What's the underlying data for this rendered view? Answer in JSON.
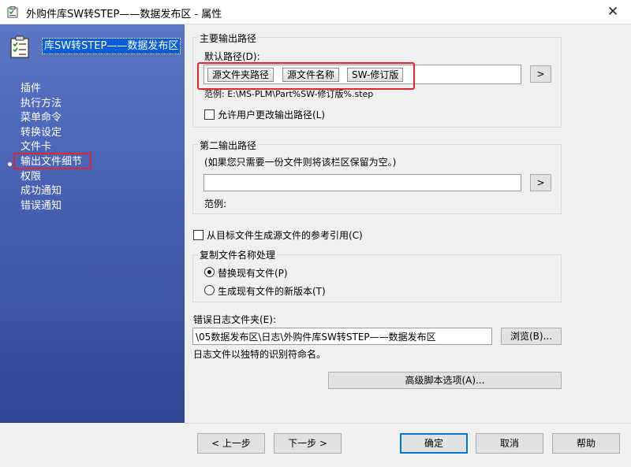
{
  "window": {
    "title": "外购件库SW转STEP——数据发布区 - 属性",
    "close_glyph": "✕"
  },
  "sidebar": {
    "item_name": "库SW转STEP——数据发布区",
    "items": [
      "插件",
      "执行方法",
      "菜单命令",
      "转换设定",
      "文件卡",
      "输出文件细节",
      "权限",
      "成功通知",
      "错误通知"
    ],
    "selected_index": 5
  },
  "primary_output": {
    "group_label": "主要输出路径",
    "default_path_label": "默认路径(D):",
    "tokens": [
      "源文件夹路径",
      "源文件名称",
      "SW-修订版"
    ],
    "browse_label": ">",
    "example": "范例: E:\\MS-PLM\\Part%SW-修订版%.step",
    "allow_change_label": "允许用户更改输出路径(L)",
    "allow_change_checked": false
  },
  "secondary_output": {
    "group_label": "第二输出路径",
    "hint": "(如果您只需要一份文件则将该栏区保留为空。)",
    "value": "",
    "browse_label": ">",
    "example": "范例:"
  },
  "reference": {
    "label": "从目标文件生成源文件的参考引用(C)",
    "checked": false
  },
  "copy_handling": {
    "group_label": "复制文件名称处理",
    "options": [
      {
        "label": "替换现有文件(P)",
        "selected": true
      },
      {
        "label": "生成现有文件的新版本(T)",
        "selected": false
      }
    ]
  },
  "error_log": {
    "label": "错误日志文件夹(E):",
    "value": "\\05数据发布区\\日志\\外购件库SW转STEP——数据发布区",
    "browse_label": "浏览(B)...",
    "note": "日志文件以独特的识别符命名。"
  },
  "advanced_button": "高级脚本选项(A)...",
  "footer": {
    "prev": "< 上一步",
    "next": "下一步 >",
    "ok": "确定",
    "cancel": "取消",
    "help": "帮助"
  },
  "colors": {
    "highlight": "#e0262e",
    "sidebar_top": "#5b76c4",
    "sidebar_bottom": "#2f4793",
    "selection": "#0a5fd6"
  }
}
